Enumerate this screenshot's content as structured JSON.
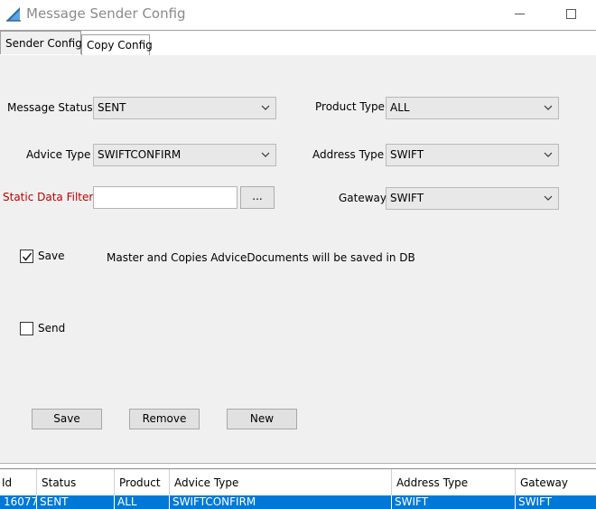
{
  "window": {
    "title": "Message Sender Config",
    "minimize_icon": "minimize-icon",
    "maximize_icon": "maximize-icon"
  },
  "tabs": [
    {
      "label": "Sender Config",
      "active": true
    },
    {
      "label": "Copy Config",
      "active": false
    }
  ],
  "form": {
    "message_status": {
      "label": "Message Status",
      "value": "SENT"
    },
    "advice_type": {
      "label": "Advice Type",
      "value": "SWIFTCONFIRM"
    },
    "static_data_filter": {
      "label": "Static Data Filter",
      "value": "",
      "browse_label": "..."
    },
    "product_type": {
      "label": "Product Type",
      "value": "ALL"
    },
    "address_type": {
      "label": "Address Type",
      "value": "SWIFT"
    },
    "gateway": {
      "label": "Gateway",
      "value": "SWIFT"
    },
    "save_checkbox": {
      "label": "Save",
      "checked": true
    },
    "save_info": "Master and Copies AdviceDocuments will be saved in DB",
    "send_checkbox": {
      "label": "Send",
      "checked": false
    }
  },
  "actions": {
    "save": "Save",
    "remove": "Remove",
    "new": "New"
  },
  "table": {
    "columns": [
      "Id",
      "Status",
      "Product",
      "Advice Type",
      "Address Type",
      "Gateway"
    ],
    "rows": [
      [
        "16077",
        "SENT",
        "ALL",
        "SWIFTCONFIRM",
        "SWIFT",
        "SWIFT"
      ]
    ],
    "selected_row_color": "#0078d7"
  },
  "colors": {
    "panel_bg": "#f0f0f0",
    "required_label": "#c00000",
    "accent": "#0078d7"
  }
}
